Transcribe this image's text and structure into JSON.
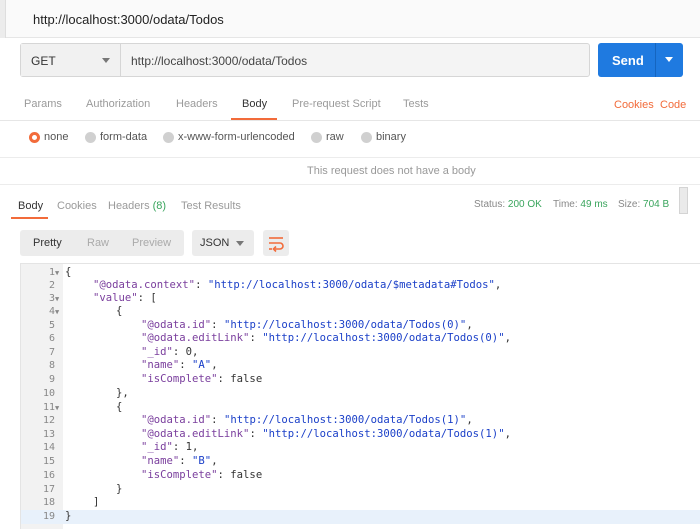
{
  "tab": {
    "title": "http://localhost:3000/odata/Todos"
  },
  "request": {
    "method": "GET",
    "url": "http://localhost:3000/odata/Todos",
    "send_label": "Send"
  },
  "request_tabs": [
    {
      "label": "Params"
    },
    {
      "label": "Authorization"
    },
    {
      "label": "Headers"
    },
    {
      "label": "Body"
    },
    {
      "label": "Pre-request Script"
    },
    {
      "label": "Tests"
    }
  ],
  "request_links": {
    "cookies": "Cookies",
    "code": "Code"
  },
  "body_types": [
    {
      "label": "none"
    },
    {
      "label": "form-data"
    },
    {
      "label": "x-www-form-urlencoded"
    },
    {
      "label": "raw"
    },
    {
      "label": "binary"
    }
  ],
  "no_body_message": "This request does not have a body",
  "response_tabs": [
    {
      "label": "Body"
    },
    {
      "label": "Cookies"
    },
    {
      "label": "Headers",
      "count": "(8)"
    },
    {
      "label": "Test Results"
    }
  ],
  "status": {
    "status_label": "Status:",
    "status_value": "200 OK",
    "time_label": "Time:",
    "time_value": "49 ms",
    "size_label": "Size:",
    "size_value": "704 B"
  },
  "view_modes": [
    {
      "label": "Pretty"
    },
    {
      "label": "Raw"
    },
    {
      "label": "Preview"
    }
  ],
  "format": "JSON",
  "colors": {
    "accent": "#f26b3a",
    "send": "#1f7ae0",
    "ok": "#3aa55d"
  },
  "icons": {
    "wrap": "wrap-lines-icon"
  },
  "code": {
    "line_numbers": [
      "1",
      "2",
      "3",
      "4",
      "5",
      "6",
      "7",
      "8",
      "9",
      "10",
      "11",
      "12",
      "13",
      "14",
      "15",
      "16",
      "17",
      "18",
      "19"
    ],
    "l1": "{",
    "l2_key": "\"@odata.context\"",
    "l2_sep": ": ",
    "l2_val": "\"http://localhost:3000/odata/$metadata#Todos\"",
    "l2_end": ",",
    "l3_key": "\"value\"",
    "l3_rest": ": [",
    "l4": "{",
    "l5_key": "\"@odata.id\"",
    "l5_sep": ": ",
    "l5_val": "\"http://localhost:3000/odata/Todos(0)\"",
    "l5_end": ",",
    "l6_key": "\"@odata.editLink\"",
    "l6_sep": ": ",
    "l6_val": "\"http://localhost:3000/odata/Todos(0)\"",
    "l6_end": ",",
    "l7_key": "\"_id\"",
    "l7_rest": ": 0,",
    "l8_key": "\"name\"",
    "l8_sep": ": ",
    "l8_val": "\"A\"",
    "l8_end": ",",
    "l9_key": "\"isComplete\"",
    "l9_rest": ": false",
    "l10": "},",
    "l11": "{",
    "l12_key": "\"@odata.id\"",
    "l12_sep": ": ",
    "l12_val": "\"http://localhost:3000/odata/Todos(1)\"",
    "l12_end": ",",
    "l13_key": "\"@odata.editLink\"",
    "l13_sep": ": ",
    "l13_val": "\"http://localhost:3000/odata/Todos(1)\"",
    "l13_end": ",",
    "l14_key": "\"_id\"",
    "l14_rest": ": 1,",
    "l15_key": "\"name\"",
    "l15_sep": ": ",
    "l15_val": "\"B\"",
    "l15_end": ",",
    "l16_key": "\"isComplete\"",
    "l16_rest": ": false",
    "l17": "}",
    "l18": "]",
    "l19": "}"
  }
}
